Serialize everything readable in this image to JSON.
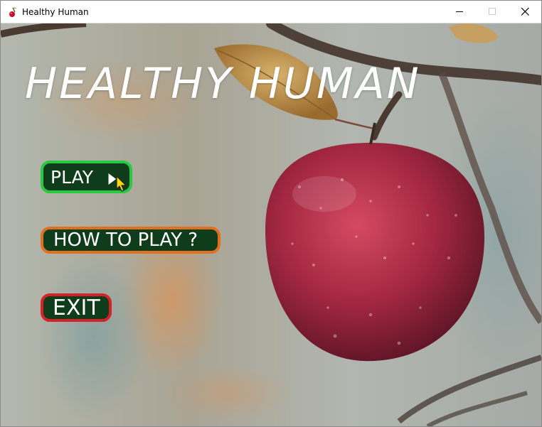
{
  "window": {
    "title": "Healthy Human",
    "controls": {
      "minimize": "minimize",
      "maximize": "maximize",
      "close": "close"
    }
  },
  "game": {
    "title": "HEALTHY HUMAN",
    "buttons": {
      "play": "PLAY",
      "how_to_play": "HOW TO PLAY ?",
      "exit": "EXIT"
    }
  },
  "colors": {
    "play_border": "#28c840",
    "how_to_play_border": "#e07020",
    "exit_border": "#d6202a",
    "button_fill": "#0f3d1c"
  },
  "icons": {
    "app": "cherry-icon",
    "cursor": "mouse-cursor-icon",
    "background": "red-apple-on-branch-photo"
  }
}
